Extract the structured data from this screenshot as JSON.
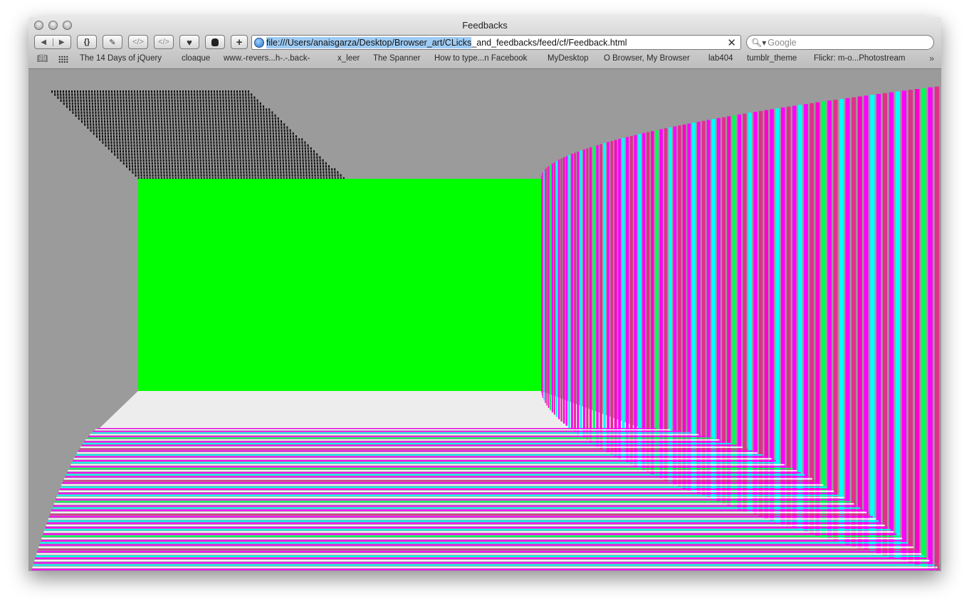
{
  "window": {
    "title": "Feedbacks"
  },
  "toolbar": {
    "back_icon": "back-arrow-icon",
    "forward_icon": "forward-arrow-icon",
    "buttons": [
      {
        "label": "{}",
        "name": "braces-button"
      },
      {
        "label": "",
        "name": "pen-button"
      },
      {
        "label": "</>",
        "name": "source-button"
      },
      {
        "label": "</>",
        "name": "snippet-button"
      },
      {
        "label": "",
        "name": "favorite-button"
      },
      {
        "label": "",
        "name": "hand-button"
      },
      {
        "label": "+",
        "name": "add-bookmark-button"
      }
    ],
    "url": {
      "selected": "file:///Users/anaisgarza/Desktop/Browser_art/CLicks",
      "rest": "_and_feedbacks/feed/cf/Feedback.html"
    },
    "search_placeholder": "Google"
  },
  "bookmarks": [
    "The 14 Days of jQuery",
    "cloaque",
    "www.-revers...h-.-.back-",
    "x_leer",
    "The Spanner",
    "How to type...n Facebook",
    "MyDesktop",
    "O Browser, My Browser",
    "lab404",
    "tumblr_theme",
    "Flickr: m-o...Photostream"
  ],
  "scene": {
    "background": "#9b9b9b",
    "back_wall": "#00ff00",
    "floor": "#ededed",
    "stripe_colors": [
      "#ff00ff",
      "#00ffff",
      "#ff00cc",
      "#00ff55",
      "#e0308a",
      "#ffffff"
    ],
    "ceiling_glyph_color": "#111111"
  }
}
